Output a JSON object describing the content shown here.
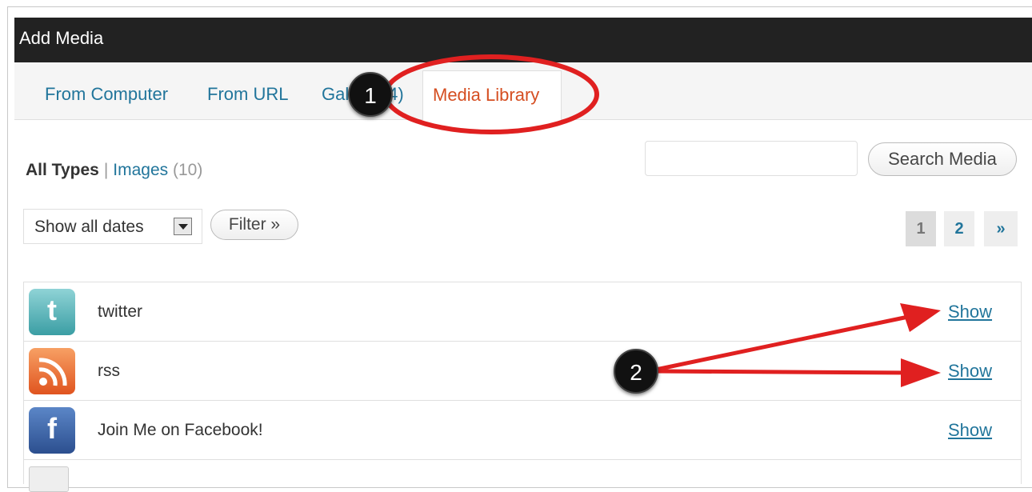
{
  "dialog": {
    "title": "Add Media"
  },
  "tabs": [
    {
      "label": "From Computer"
    },
    {
      "label": "From URL"
    },
    {
      "label": "Gallery (4)"
    },
    {
      "label": "Media Library"
    }
  ],
  "filters": {
    "all_types": "All Types",
    "separator": "|",
    "images_label": "Images",
    "images_count": "(10)",
    "date_select": "Show all dates",
    "filter_button": "Filter »"
  },
  "search": {
    "value": "",
    "button": "Search Media"
  },
  "pagination": {
    "pages": [
      "1",
      "2"
    ],
    "current": "1",
    "next": "»"
  },
  "media_items": [
    {
      "title": "twitter",
      "icon": "twitter-icon",
      "action": "Show"
    },
    {
      "title": "rss",
      "icon": "rss-icon",
      "action": "Show"
    },
    {
      "title": "Join Me on Facebook!",
      "icon": "facebook-icon",
      "action": "Show"
    }
  ],
  "annotations": {
    "callout1": "1",
    "callout2": "2"
  },
  "colors": {
    "link": "#21759b",
    "active_tab": "#d54e21",
    "annotation": "#e02020"
  }
}
